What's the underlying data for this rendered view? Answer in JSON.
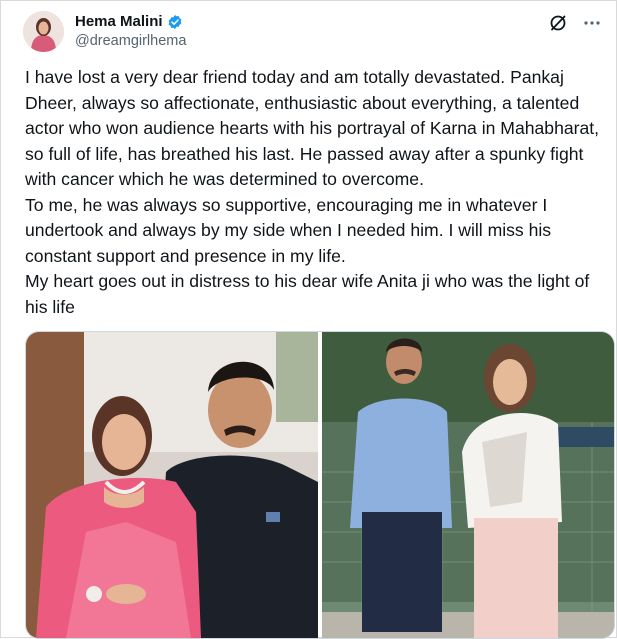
{
  "author": {
    "display_name": "Hema Malini",
    "handle": "@dreamgirlhema",
    "avatar_icon": "avatar-photo",
    "verified_icon": "verified-badge-icon"
  },
  "header_icons": {
    "grok_icon": "slash-circle-icon",
    "more_icon": "more-dots-icon"
  },
  "tweet": {
    "paragraphs": [
      "I have lost a very dear friend today and am totally devastated. Pankaj Dheer, always so affectionate, enthusiastic about everything, a talented actor who won audience hearts with his portrayal of Karna in Mahabharat, so full of life,  has breathed his last. He passed away after a spunky fight with cancer which he was determined to overcome.",
      "To me, he was always so supportive, encouraging me in whatever I undertook and always by my side when I needed him. I will miss his constant support and presence in my life.",
      "My heart goes out in distress to his dear wife Anita ji who was the light of his life"
    ]
  },
  "media": {
    "images": [
      {
        "name": "photo-woman-pink-saree-man-black-sweater"
      },
      {
        "name": "photo-couple-outdoors-sports-ground"
      }
    ]
  },
  "colors": {
    "verified_blue": "#1d9bf0",
    "text": "#0f1419",
    "muted": "#536471",
    "saree_pink": "#e9567a"
  }
}
